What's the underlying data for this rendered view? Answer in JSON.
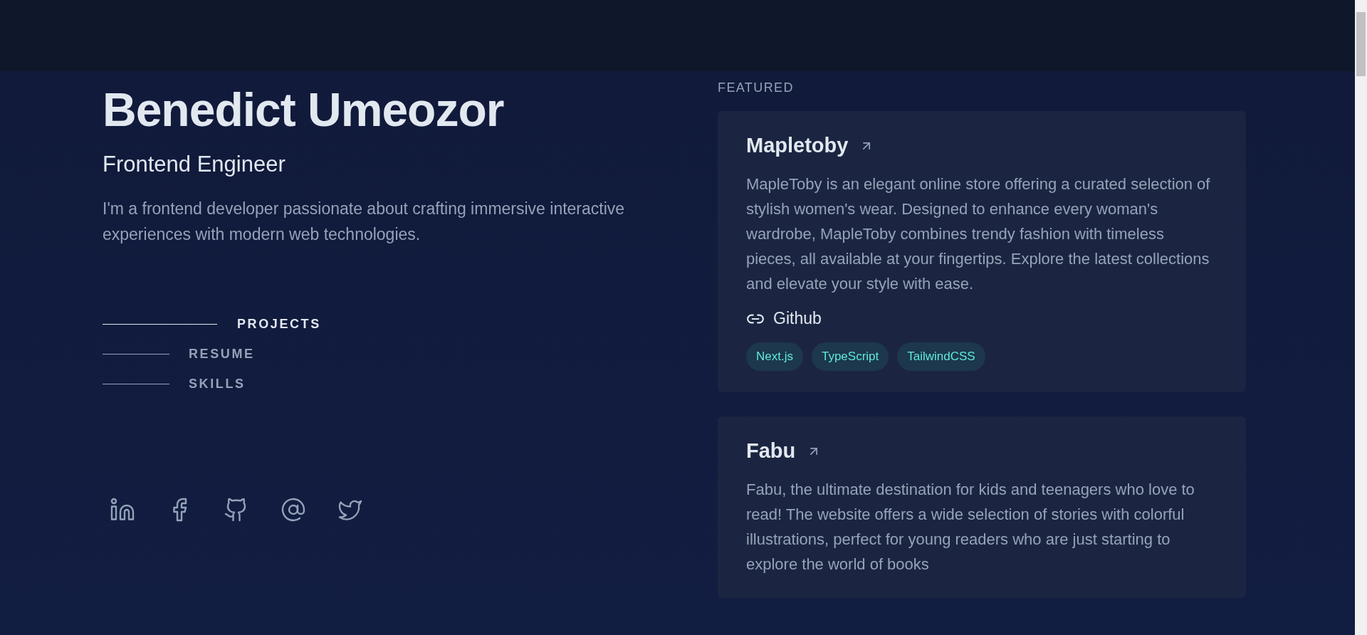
{
  "profile": {
    "name": "Benedict Umeozor",
    "role": "Frontend Engineer",
    "bio": "I'm a frontend developer passionate about crafting immersive interactive experiences with modern web technologies."
  },
  "nav": [
    {
      "label": "PROJECTS",
      "selected": true
    },
    {
      "label": "RESUME",
      "selected": false
    },
    {
      "label": "SKILLS",
      "selected": false
    }
  ],
  "socials": [
    {
      "kind": "linkedin"
    },
    {
      "kind": "facebook"
    },
    {
      "kind": "github"
    },
    {
      "kind": "email"
    },
    {
      "kind": "twitter"
    }
  ],
  "featured": {
    "heading": "FEATURED",
    "projects": [
      {
        "title": "Mapletoby",
        "description": "MapleToby is an elegant online store offering a curated selection of stylish women's wear. Designed to enhance every woman's wardrobe, MapleToby combines trendy fashion with timeless pieces, all available at your fingertips. Explore the latest collections and elevate your style with ease.",
        "link": "Github",
        "tags": [
          "Next.js",
          "TypeScript",
          "TailwindCSS"
        ]
      },
      {
        "title": "Fabu",
        "description": "Fabu, the ultimate destination for kids and teenagers who love to read! The website offers a wide selection of stories with colorful illustrations, perfect for young readers who are just starting to explore the world of books"
      }
    ]
  }
}
